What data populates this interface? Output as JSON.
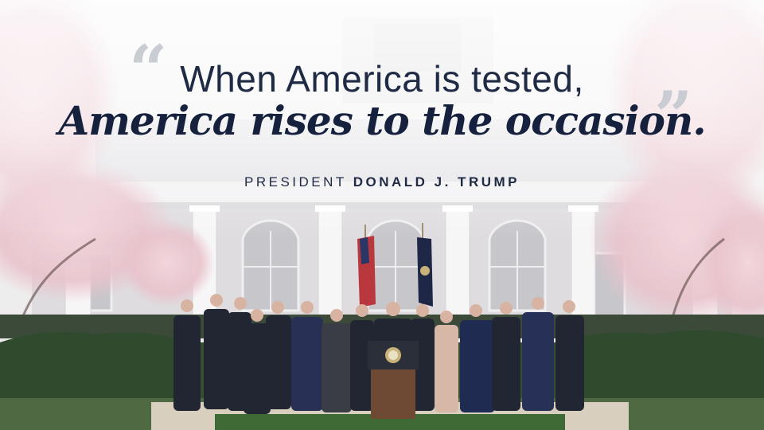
{
  "quote": {
    "open_mark": "“",
    "close_mark": "”",
    "line1": "When America is tested,",
    "line2": "America rises to the occasion."
  },
  "attribution": {
    "title": "PRESIDENT",
    "name": "DONALD J. TRUMP"
  },
  "colors": {
    "text_navy": "#1f2a44",
    "headline_navy": "#16213e",
    "quote_mark_gray": "#c9ccd3"
  }
}
